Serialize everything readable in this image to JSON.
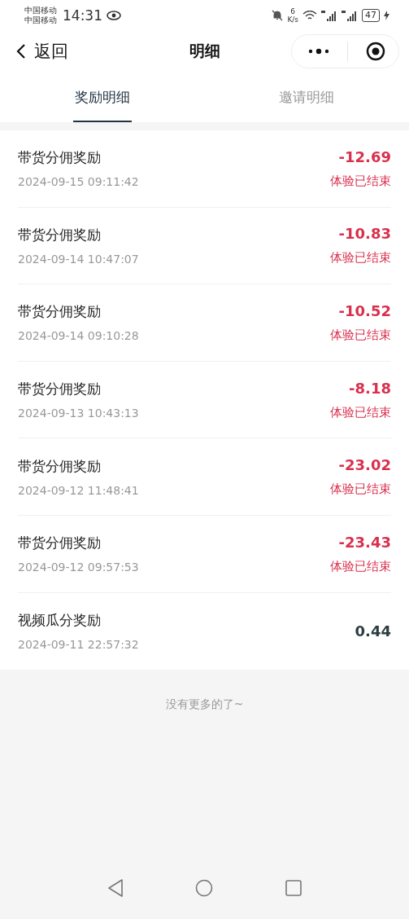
{
  "status_bar": {
    "carriers": [
      "中国移动",
      "中国移动"
    ],
    "time": "14:31",
    "net_speed_value": "6",
    "net_speed_unit": "K/s",
    "battery": "47"
  },
  "nav": {
    "back": "返回",
    "title": "明细"
  },
  "tabs": [
    {
      "label": "奖励明细",
      "selected": true
    },
    {
      "label": "邀请明细",
      "selected": false
    }
  ],
  "records": [
    {
      "kind": "deduction",
      "title": "带货分佣奖励",
      "time": "2024-09-15 09:11:42",
      "amount": "-12.69",
      "status": "体验已结束"
    },
    {
      "kind": "deduction",
      "title": "带货分佣奖励",
      "time": "2024-09-14 10:47:07",
      "amount": "-10.83",
      "status": "体验已结束"
    },
    {
      "kind": "deduction",
      "title": "带货分佣奖励",
      "time": "2024-09-14 09:10:28",
      "amount": "-10.52",
      "status": "体验已结束"
    },
    {
      "kind": "deduction",
      "title": "带货分佣奖励",
      "time": "2024-09-13 10:43:13",
      "amount": "-8.18",
      "status": "体验已结束"
    },
    {
      "kind": "deduction",
      "title": "带货分佣奖励",
      "time": "2024-09-12 11:48:41",
      "amount": "-23.02",
      "status": "体验已结束"
    },
    {
      "kind": "deduction",
      "title": "带货分佣奖励",
      "time": "2024-09-12 09:57:53",
      "amount": "-23.43",
      "status": "体验已结束"
    },
    {
      "kind": "income",
      "title": "视频瓜分奖励",
      "time": "2024-09-11 22:57:32",
      "amount": "0.44"
    }
  ],
  "end_note": "没有更多的了~"
}
